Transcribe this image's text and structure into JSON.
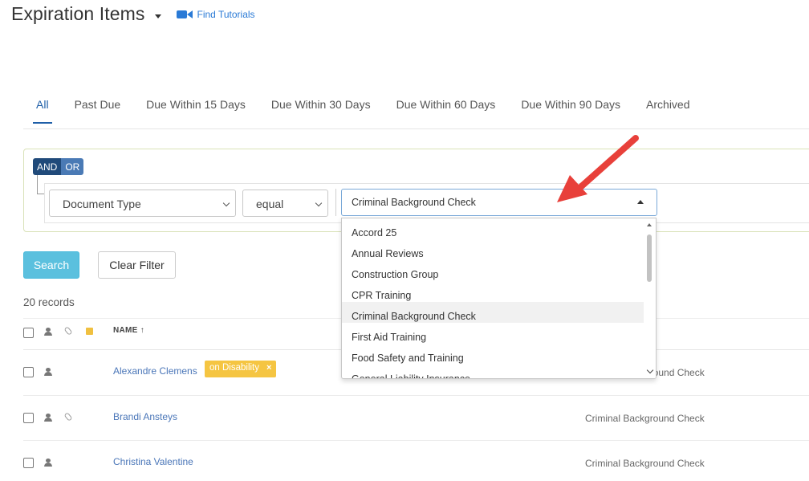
{
  "header": {
    "title": "Expiration Items",
    "tutorial_link": "Find Tutorials"
  },
  "tabs": [
    {
      "label": "All",
      "active": true
    },
    {
      "label": "Past Due"
    },
    {
      "label": "Due Within 15 Days"
    },
    {
      "label": "Due Within 30 Days"
    },
    {
      "label": "Due Within 60 Days"
    },
    {
      "label": "Due Within 90 Days"
    },
    {
      "label": "Archived"
    }
  ],
  "filter": {
    "and_label": "AND",
    "or_label": "OR",
    "field": "Document Type",
    "operator": "equal",
    "value": "Criminal Background Check",
    "options": [
      "Accord 25",
      "Annual Reviews",
      "Construction Group",
      "CPR Training",
      "Criminal Background Check",
      "First Aid Training",
      "Food Safety and Training",
      "General Liability Insurance"
    ]
  },
  "buttons": {
    "search": "Search",
    "clear": "Clear Filter"
  },
  "record_count": "20 records",
  "table": {
    "name_header": "NAME ↑",
    "rows": [
      {
        "name": "Alexandre Clemens",
        "tag": "on Disability",
        "document": "Criminal Background Check"
      },
      {
        "name": "Brandi Ansteys",
        "document": "Criminal Background Check"
      },
      {
        "name": "Christina Valentine",
        "document": "Criminal Background Check"
      }
    ]
  },
  "colors": {
    "accent": "#1f5fa8",
    "search_button": "#5bc0de",
    "tag": "#f5c542",
    "link": "#4a76b8",
    "annotation_arrow": "#e8403a"
  }
}
